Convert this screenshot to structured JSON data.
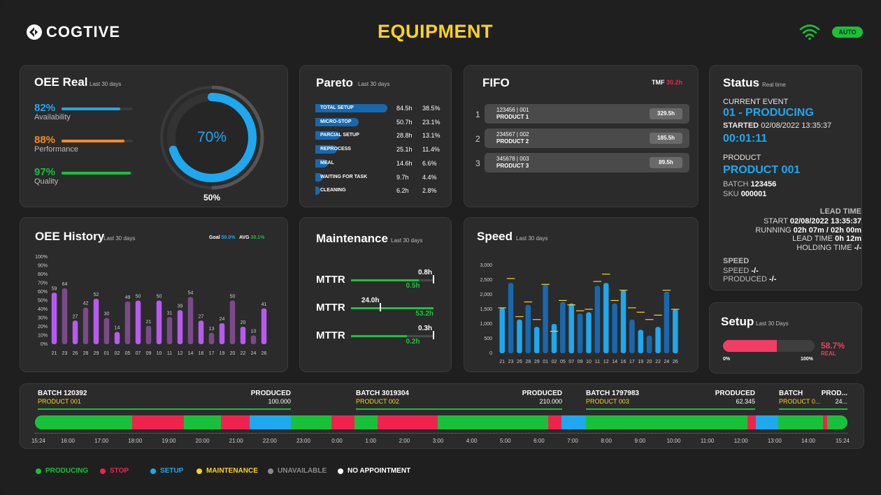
{
  "header": {
    "logo_text": "COGTIVE",
    "title": "EQUIPMENT",
    "mode_badge": "AUTO",
    "wifi_icon": "wifi-icon"
  },
  "colors": {
    "producing": "#18c13a",
    "stop": "#f0234f",
    "setup": "#1ea8f0",
    "maintenance": "#ffd21f",
    "unavailable": "#8a8a8a",
    "no_appointment": "#ffffff",
    "history_bar": "#b85af0",
    "history_bar_dark": "#7a4a8a",
    "speed_bar": "#1ea8f0",
    "speed_bar_dark": "#1868b0"
  },
  "oee_real": {
    "title": "OEE Real",
    "subtitle": "Last 30 days",
    "gauge_value": "70%",
    "gauge_fraction": 0.7,
    "gauge_goal": "50%",
    "kpis": [
      {
        "pct": "82%",
        "label": "Availability",
        "fraction": 0.82,
        "color": "#1ea8f0"
      },
      {
        "pct": "88%",
        "label": "Performance",
        "fraction": 0.88,
        "color": "#f58a1f"
      },
      {
        "pct": "97%",
        "label": "Quality",
        "fraction": 0.97,
        "color": "#18c13a"
      }
    ]
  },
  "pareto": {
    "title": "Pareto",
    "subtitle": "Last 30 days",
    "rows": [
      {
        "label": "TOTAL SETUP",
        "hours": "84.5h",
        "pct": "38.5%",
        "fraction": 1.0
      },
      {
        "label": "MICRO-STOP",
        "hours": "50.7h",
        "pct": "23.1%",
        "fraction": 0.6
      },
      {
        "label": "PARCIAL SETUP",
        "hours": "28.8h",
        "pct": "13.1%",
        "fraction": 0.34
      },
      {
        "label": "REPROCESS",
        "hours": "25.1h",
        "pct": "11.4%",
        "fraction": 0.3
      },
      {
        "label": "MEAL",
        "hours": "14.6h",
        "pct": "6.6%",
        "fraction": 0.17
      },
      {
        "label": "WAITING FOR TASK",
        "hours": "9.7h",
        "pct": "4.4%",
        "fraction": 0.11
      },
      {
        "label": "CLEANING",
        "hours": "6.2h",
        "pct": "2.8%",
        "fraction": 0.07
      }
    ]
  },
  "fifo": {
    "title": "FIFO",
    "tmf_label": "TMF",
    "tmf_value": "30.2h",
    "rows": [
      {
        "index": "1",
        "code": "123456 | 001",
        "product": "PRODUCT 1",
        "time": "329.5h"
      },
      {
        "index": "2",
        "code": "234567 | 002",
        "product": "PRODUCT 2",
        "time": "185.5h"
      },
      {
        "index": "3",
        "code": "345678 | 003",
        "product": "PRODUCT 3",
        "time": "89.5h"
      }
    ]
  },
  "status": {
    "title": "Status",
    "subtitle": "Real time",
    "current_event_label": "CURRENT EVENT",
    "current_event": "01 - PRODUCING",
    "started_label": "STARTED",
    "started_value": "02/08/2022 13:35:37",
    "elapsed": "00:01:11",
    "product_label": "PRODUCT",
    "product_value": "PRODUCT 001",
    "batch_label": "BATCH",
    "batch_value": "123456",
    "sku_label": "SKU",
    "sku_value": "000001",
    "lead_time_header": "LEAD TIME",
    "start_label": "START",
    "start_value": "02/08/2022 13:35:37",
    "running_label": "RUNNING",
    "running_value": "02h 07m / 02h 00m",
    "lead_time_label": "LEAD TIME",
    "lead_time_value": "0h 12m",
    "holding_label": "HOLDING TIME",
    "holding_value": "-/-",
    "speed_header": "SPEED",
    "speed_label": "SPEED",
    "speed_value": "-/-",
    "produced_label": "PRODUCED",
    "produced_value": "-/-"
  },
  "setup": {
    "title": "Setup",
    "subtitle": "Last 30 Days",
    "fraction": 0.587,
    "value": "58.7%",
    "real_label": "REAL",
    "min_label": "0%",
    "max_label": "100%"
  },
  "maintenance": {
    "title": "Maintenance",
    "subtitle": "Last 30 days",
    "rows": [
      {
        "label": "MTTR",
        "value": "0.8h",
        "goal": "0.5h",
        "fill": 0.82,
        "marker": 1.0
      },
      {
        "label": "MTTR",
        "value": "24.0h",
        "goal": "53.2h",
        "fill": 1.0,
        "marker": 0.36
      },
      {
        "label": "MTTR",
        "value": "0.3h",
        "goal": "0.2h",
        "fill": 0.68,
        "marker": 1.0
      }
    ]
  },
  "oee_history": {
    "title": "OEE History",
    "subtitle": "Last 30 days",
    "goal_label": "Goal",
    "goal_value": "50.0%",
    "avg_label": "AVG",
    "avg_value": "30.1%"
  },
  "speed": {
    "title": "Speed",
    "subtitle": "Last 30 days"
  },
  "chart_data": [
    {
      "type": "bar",
      "title": "OEE History",
      "categories": [
        "21",
        "23",
        "26",
        "28",
        "29",
        "01",
        "02",
        "05",
        "07",
        "09",
        "10",
        "11",
        "12",
        "14",
        "16",
        "17",
        "19",
        "20",
        "22",
        "24",
        "26"
      ],
      "values": [
        59,
        64,
        27,
        42,
        52,
        30,
        14,
        49,
        50,
        21,
        50,
        31,
        39,
        54,
        27,
        13,
        24,
        50,
        20,
        10,
        41
      ],
      "yticks": [
        "100%",
        "90%",
        "80%",
        "70%",
        "60%",
        "50%",
        "40%",
        "30%",
        "20%",
        "10%",
        "0%"
      ],
      "ylim": [
        0,
        100
      ]
    },
    {
      "type": "bar",
      "title": "Speed",
      "categories": [
        "21",
        "23",
        "26",
        "28",
        "29",
        "01",
        "02",
        "05",
        "07",
        "09",
        "10",
        "11",
        "12",
        "14",
        "16",
        "17",
        "19",
        "20",
        "22",
        "24",
        "26"
      ],
      "values": [
        1550,
        2400,
        1150,
        1650,
        900,
        2350,
        1000,
        1750,
        1700,
        1350,
        1400,
        2300,
        2400,
        1700,
        2150,
        1150,
        800,
        600,
        900,
        2100,
        1500
      ],
      "targets": [
        1550,
        2550,
        1250,
        1750,
        1150,
        2350,
        750,
        1800,
        1650,
        1450,
        1500,
        2450,
        2700,
        1800,
        2150,
        1550,
        1400,
        1150,
        1300,
        2150,
        1500
      ],
      "yticks": [
        "3,000",
        "2,500",
        "2,000",
        "1,500",
        "1,000",
        "500",
        "0"
      ],
      "ylim": [
        0,
        3000
      ]
    }
  ],
  "timeline": {
    "batches": [
      {
        "batch": "BATCH 120392",
        "product": "PRODUCT 001",
        "produced_label": "PRODUCED",
        "produced_value": "100.000"
      },
      {
        "batch": "BATCH 3019304",
        "product": "PRODUCT 002",
        "produced_label": "PRODUCED",
        "produced_value": "210.000"
      },
      {
        "batch": "BATCH 1797983",
        "product": "PRODUCT 003",
        "produced_label": "PRODUCED",
        "produced_value": "62.345"
      },
      {
        "batch": "BATCH",
        "product": "PRODUCT 0...",
        "produced_label": "PROD...",
        "produced_value": "24..."
      }
    ],
    "segments": [
      {
        "state": "producing",
        "start": 0.0,
        "end": 0.12
      },
      {
        "state": "stop",
        "start": 0.12,
        "end": 0.183
      },
      {
        "state": "producing",
        "start": 0.183,
        "end": 0.229
      },
      {
        "state": "stop",
        "start": 0.229,
        "end": 0.264
      },
      {
        "state": "setup",
        "start": 0.264,
        "end": 0.315
      },
      {
        "state": "producing",
        "start": 0.315,
        "end": 0.365
      },
      {
        "state": "stop",
        "start": 0.365,
        "end": 0.393
      },
      {
        "state": "producing",
        "start": 0.393,
        "end": 0.422
      },
      {
        "state": "stop",
        "start": 0.422,
        "end": 0.496
      },
      {
        "state": "producing",
        "start": 0.496,
        "end": 0.632
      },
      {
        "state": "stop",
        "start": 0.632,
        "end": 0.648
      },
      {
        "state": "setup",
        "start": 0.648,
        "end": 0.678
      },
      {
        "state": "producing",
        "start": 0.678,
        "end": 0.877
      },
      {
        "state": "stop",
        "start": 0.877,
        "end": 0.887
      },
      {
        "state": "setup",
        "start": 0.887,
        "end": 0.915
      },
      {
        "state": "producing",
        "start": 0.915,
        "end": 0.97
      },
      {
        "state": "stop",
        "start": 0.97,
        "end": 0.975
      },
      {
        "state": "producing",
        "start": 0.975,
        "end": 1.0
      }
    ],
    "ticks": [
      "15:24",
      "16:00",
      "17:00",
      "18:00",
      "19:00",
      "20:00",
      "21:00",
      "22:00",
      "23:00",
      "0:00",
      "1:00",
      "2:00",
      "3:00",
      "4:00",
      "5:00",
      "6:00",
      "7:00",
      "8:00",
      "9:00",
      "10:00",
      "11:00",
      "12:00",
      "13:00",
      "14:00",
      "15:24"
    ]
  },
  "legend": [
    {
      "label": "PRODUCING",
      "color": "#18c13a"
    },
    {
      "label": "STOP",
      "color": "#f0234f"
    },
    {
      "label": "SETUP",
      "color": "#1ea8f0"
    },
    {
      "label": "MAINTENANCE",
      "color": "#ffd21f"
    },
    {
      "label": "UNAVAILABLE",
      "color": "#8a8a8a"
    },
    {
      "label": "NO APPOINTMENT",
      "color": "#ffffff"
    }
  ]
}
